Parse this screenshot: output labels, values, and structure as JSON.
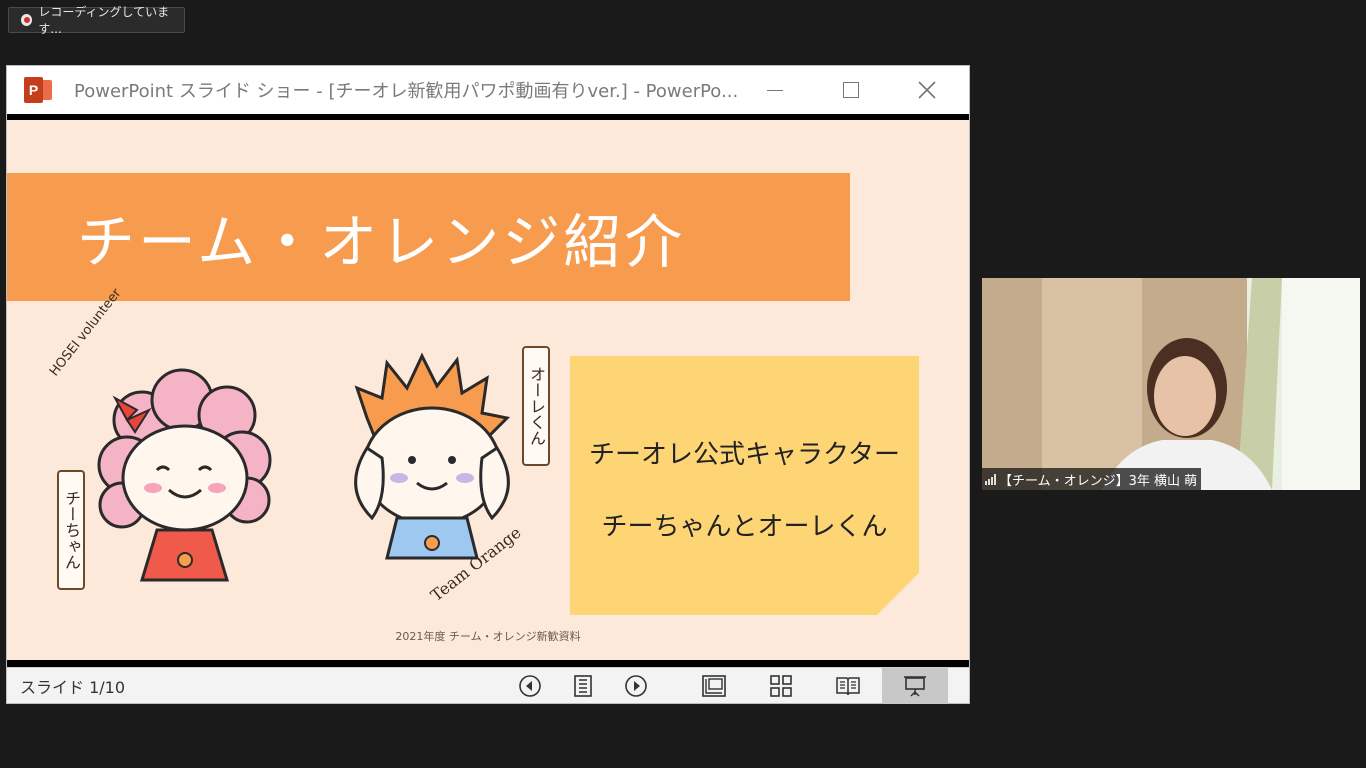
{
  "recording": {
    "label": "レコーディングしています..."
  },
  "window": {
    "title": "PowerPoint スライド ショー - [チーオレ新歓用パワポ動画有りver.] - PowerPo..."
  },
  "slide": {
    "title": "チーム・オレンジ紹介",
    "note_line1": "チーオレ公式キャラクター",
    "note_line2": "チーちゃんとオーレくん",
    "tag_chi": "チーちゃん",
    "tag_ore": "オーレくん",
    "hosei": "HOSEI volunteer",
    "team": "Team Orange",
    "footer": "2021年度 チーム・オレンジ新歓資料"
  },
  "status": {
    "counter": "スライド 1/10"
  },
  "participant": {
    "name": "【チーム・オレンジ】3年 横山 萌"
  },
  "colors": {
    "banner": "#f79b4f",
    "note": "#fdd575",
    "slide_bg": "#fde9da",
    "ppt_red": "#c43e1c"
  }
}
